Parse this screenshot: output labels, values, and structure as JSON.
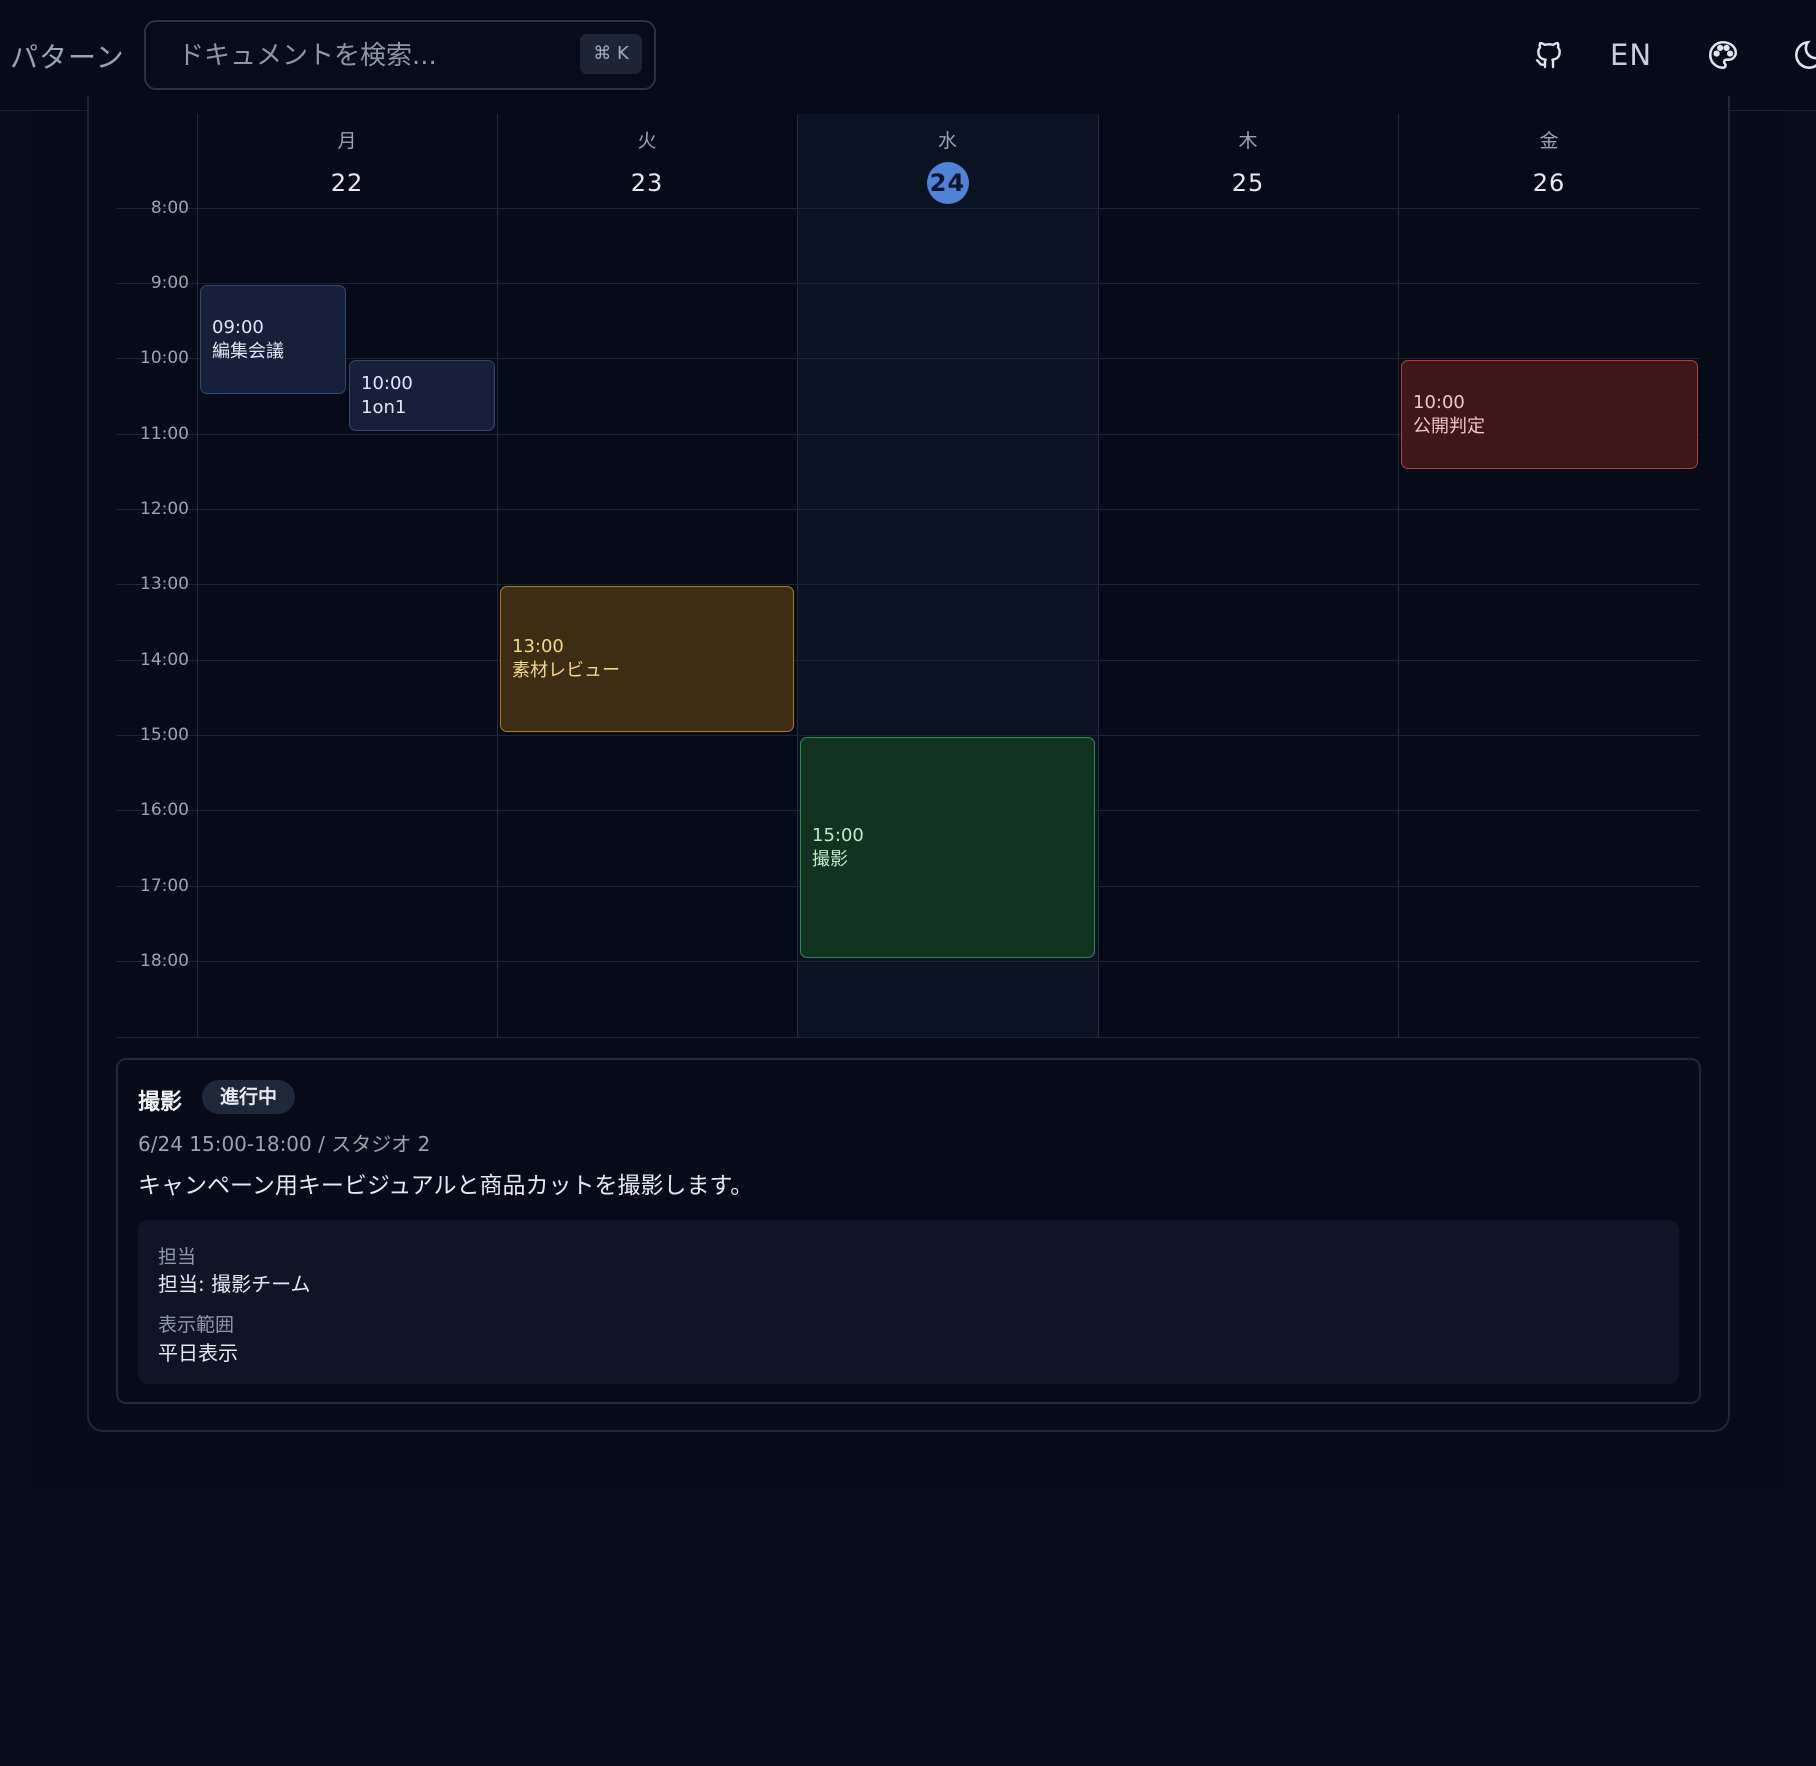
{
  "header": {
    "brand": "パターン",
    "search_placeholder": "ドキュメントを検索...",
    "search_shortcut": "⌘ K",
    "lang": "EN",
    "icons": [
      "github-icon",
      "palette-icon",
      "moon-icon"
    ]
  },
  "calendar": {
    "days": [
      {
        "dow": "月",
        "num": "22"
      },
      {
        "dow": "火",
        "num": "23"
      },
      {
        "dow": "水",
        "num": "24",
        "today": true
      },
      {
        "dow": "木",
        "num": "25"
      },
      {
        "dow": "金",
        "num": "26"
      }
    ],
    "times": [
      "8:00",
      "9:00",
      "10:00",
      "11:00",
      "12:00",
      "13:00",
      "14:00",
      "15:00",
      "16:00",
      "17:00",
      "18:00"
    ],
    "events": [
      {
        "time": "09:00",
        "title": "編集会議",
        "color": "blue"
      },
      {
        "time": "10:00",
        "title": "1on1",
        "color": "blue"
      },
      {
        "time": "13:00",
        "title": "素材レビュー",
        "color": "amber"
      },
      {
        "time": "15:00",
        "title": "撮影",
        "color": "green"
      },
      {
        "time": "10:00",
        "title": "公開判定",
        "color": "red"
      }
    ]
  },
  "detail": {
    "title": "撮影",
    "badge": "進行中",
    "meta": "6/24 15:00-18:00 / スタジオ 2",
    "description": "キャンペーン用キービジュアルと商品カットを撮影します。",
    "fields": [
      {
        "label": "担当",
        "value": "担当: 撮影チーム"
      },
      {
        "label": "表示範囲",
        "value": "平日表示"
      }
    ]
  },
  "colors": {
    "accent": "#5082d8",
    "background": "#080d1c",
    "event_blue": "#15213a",
    "event_amber": "#3d2d12",
    "event_green": "#12331f",
    "event_red": "#3e171b"
  }
}
